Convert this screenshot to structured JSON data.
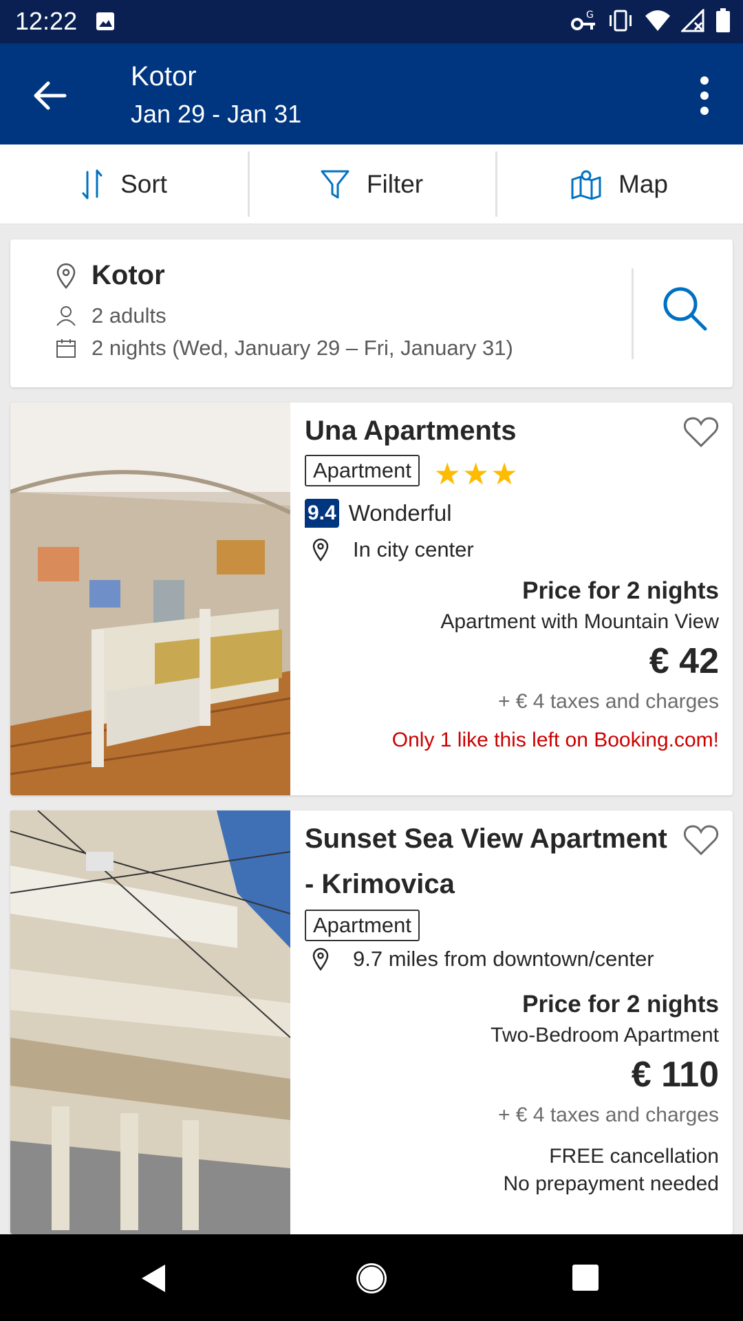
{
  "status_bar": {
    "time": "12:22",
    "icons": [
      "image-icon",
      "vpn-key-icon",
      "vibrate-icon",
      "wifi-icon",
      "signal-icon",
      "battery-icon"
    ]
  },
  "app_bar": {
    "title": "Kotor",
    "subtitle": "Jan 29 - Jan 31"
  },
  "toolbar": {
    "sort_label": "Sort",
    "filter_label": "Filter",
    "map_label": "Map",
    "icon_color": "#0071c2"
  },
  "search_summary": {
    "destination": "Kotor",
    "guests": "2 adults",
    "nights": "2 nights (Wed, January 29 – Fri, January 31)"
  },
  "properties": [
    {
      "name": "Una Apartments",
      "type": "Apartment",
      "stars": "★★★",
      "star_count": 3,
      "score": "9.4",
      "score_label": "Wonderful",
      "location": "In city center",
      "price_label": "Price for 2 nights",
      "room_type": "Apartment with Mountain View",
      "price": "€ 42",
      "taxes": "+ € 4 taxes and charges",
      "scarcity": "Only 1 like this left on Booking.com!"
    },
    {
      "name_line1": "Sunset Sea View Apartment",
      "name_line2": "- Krimovica",
      "type": "Apartment",
      "location": "9.7 miles from downtown/center",
      "price_label": "Price for 2 nights",
      "room_type": "Two-Bedroom Apartment",
      "price": "€ 110",
      "taxes": "+ € 4 taxes and charges",
      "cancellation": "FREE cancellation",
      "prepayment": "No prepayment needed"
    }
  ],
  "colors": {
    "brand_blue": "#003580",
    "status_bar": "#0a1f52",
    "accent_blue": "#0071c2",
    "star_yellow": "#febb02",
    "scarcity_red": "#cc0000"
  }
}
